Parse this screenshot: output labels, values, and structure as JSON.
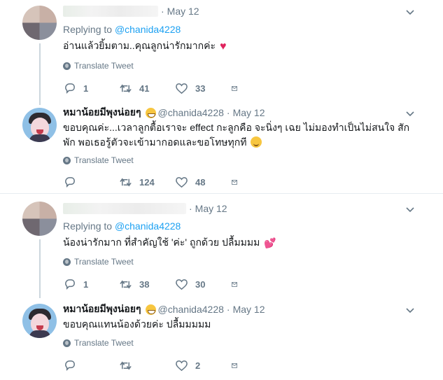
{
  "tweets": [
    {
      "date": "May 12",
      "replying_label": "Replying to",
      "replying_handle": "@chanida4228",
      "text": "อ่านแล้วยิ้มตาม..คุณลูกน่ารักมากค่ะ",
      "translate": "Translate Tweet",
      "replies": "1",
      "retweets": "41",
      "likes": "33",
      "avatar": "blurred",
      "emoji": "red-heart"
    },
    {
      "display_name": "หมาน้อยมีพุงน่อยๆ",
      "handle": "@chanida4228",
      "date": "May 12",
      "text": "ขอบคุณค่ะ...เวลาลูกตื้อเราจะ effect  กะลูกคือ จะนิ่งๆ เฉย ไม่มองทำเป็นไม่สนใจ สักพัก พอเธอรู้ตัวจะเข้ามากอดและขอโทษทุกที",
      "translate": "Translate Tweet",
      "replies": "",
      "retweets": "124",
      "likes": "48",
      "avatar": "cartoon",
      "emoji": "smiling-face"
    },
    {
      "date": "May 12",
      "replying_label": "Replying to",
      "replying_handle": "@chanida4228",
      "text": "น้องน่ารักมาก ที่สำคัญใช้ 'ค่ะ' ถูกด้วย ปลื้มมมม",
      "translate": "Translate Tweet",
      "replies": "1",
      "retweets": "38",
      "likes": "30",
      "avatar": "blurred",
      "emoji": "two-hearts"
    },
    {
      "display_name": "หมาน้อยมีพุงน่อยๆ",
      "handle": "@chanida4228",
      "date": "May 12",
      "text": "ขอบคุณแทนน้องด้วยค่ะ ปลื้มมมมม",
      "translate": "Translate Tweet",
      "replies": "",
      "retweets": "",
      "likes": "2",
      "avatar": "cartoon"
    }
  ],
  "icons": {
    "reply": "reply-icon",
    "retweet": "retweet-icon",
    "like": "heart-icon",
    "dm": "envelope-icon",
    "translate": "globe-icon",
    "caret": "chevron-down-icon"
  },
  "colors": {
    "link": "#1da1f2",
    "muted": "#657786",
    "thread_line": "#ccd6dd",
    "heart": "#e0245e"
  }
}
